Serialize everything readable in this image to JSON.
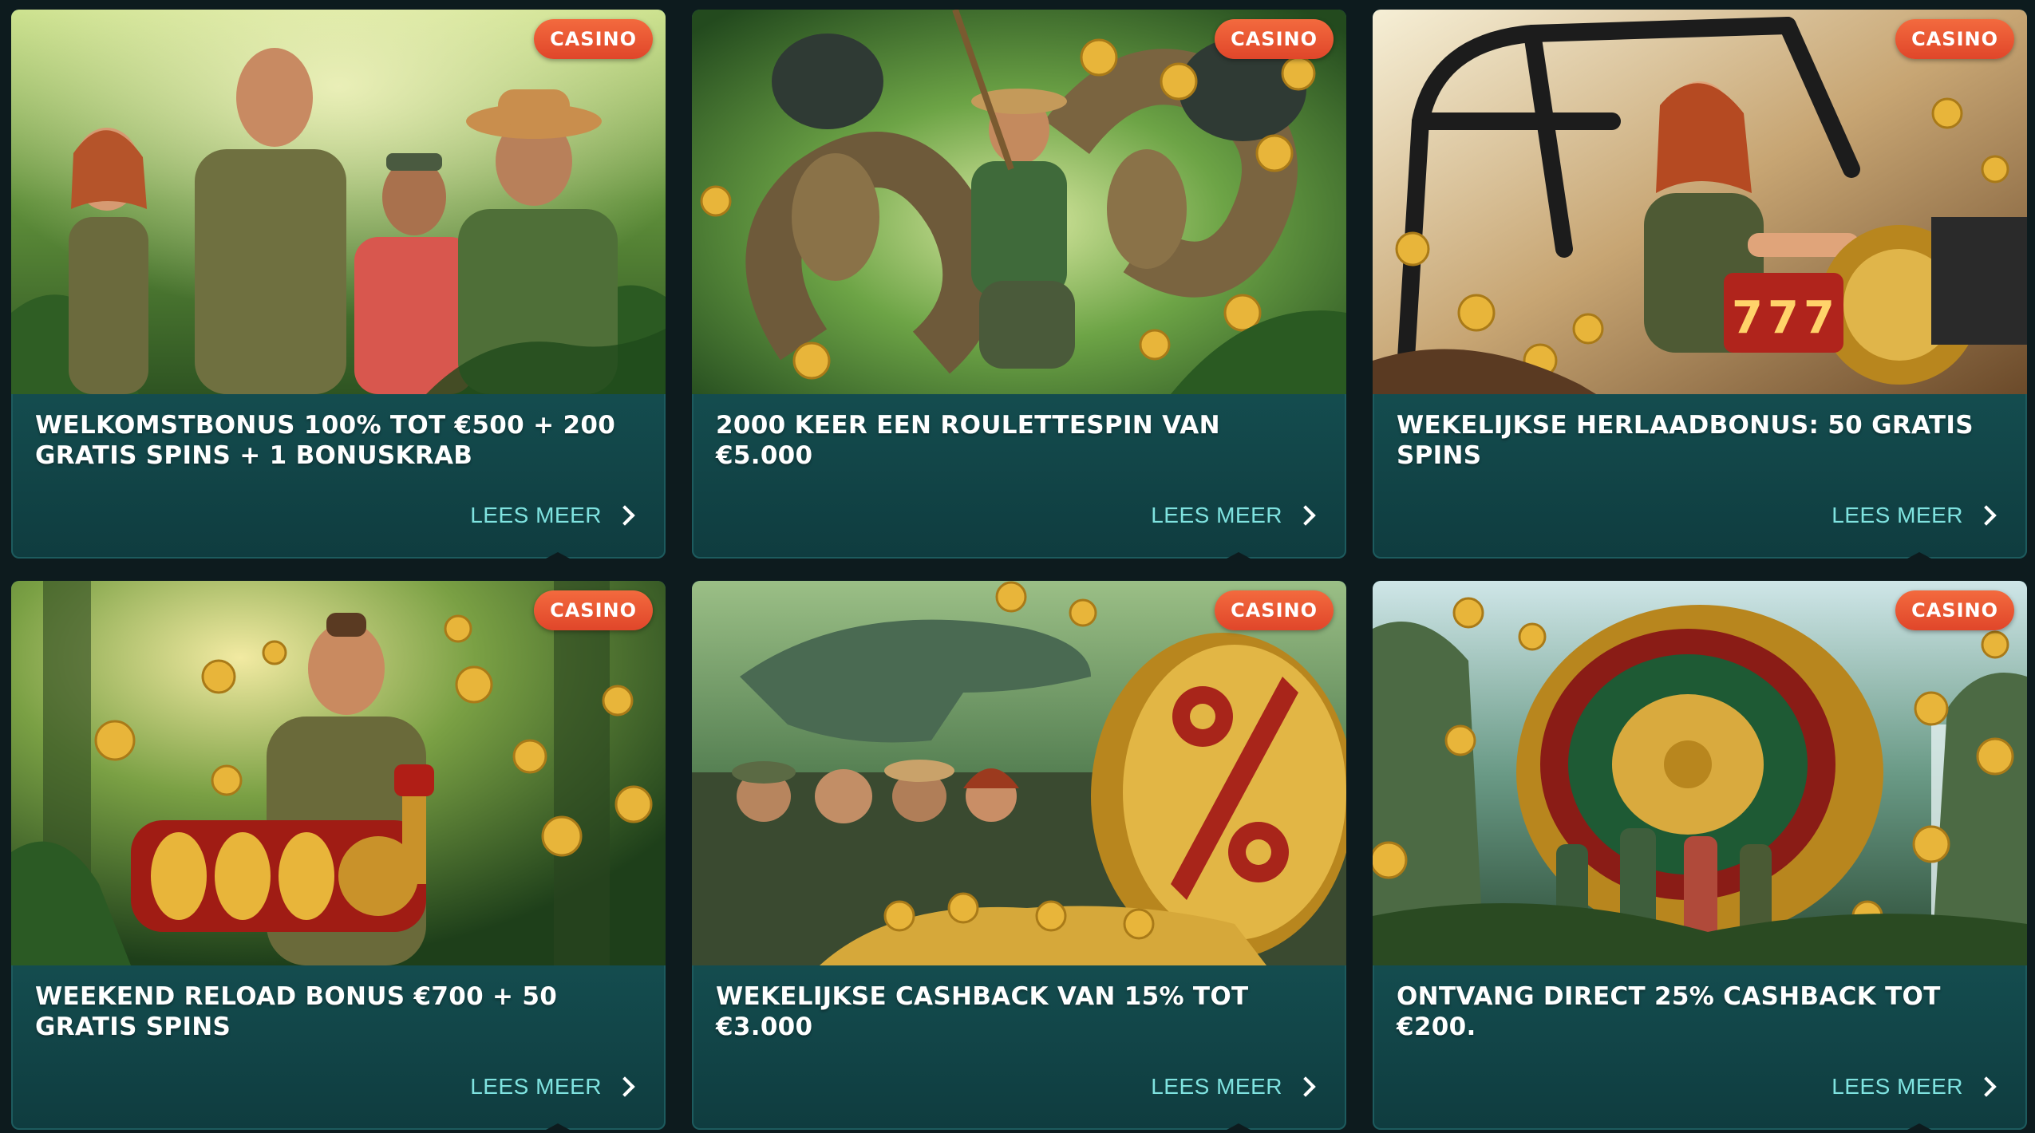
{
  "promotions": [
    {
      "badge": "CASINO",
      "title": "WELKOMSTBONUS 100% TOT €500 + 200 GRATIS SPINS + 1 BONUSKRAB",
      "link": "LEES MEER",
      "image": "jungle-explorers-group"
    },
    {
      "badge": "CASINO",
      "title": "2000 KEER EEN ROULETTESPIN VAN €5.000",
      "link": "LEES MEER",
      "image": "explorer-swinging-with-python-and-gorillas"
    },
    {
      "badge": "CASINO",
      "title": "WEKELIJKSE HERLAADBONUS: 50 GRATIS SPINS",
      "link": "LEES MEER",
      "image": "woman-driving-buggy-with-slot-reels"
    },
    {
      "badge": "CASINO",
      "title": "WEEKEND RELOAD BONUS €700 + 50 GRATIS SPINS",
      "link": "LEES MEER",
      "image": "explorer-holding-slot-reels"
    },
    {
      "badge": "CASINO",
      "title": "WEKELIJKSE CASHBACK VAN 15% TOT €3.000",
      "link": "LEES MEER",
      "image": "crocodile-and-giant-percent-coin"
    },
    {
      "badge": "CASINO",
      "title": "ONTVANG DIRECT 25% CASHBACK TOT €200.",
      "link": "LEES MEER",
      "image": "giant-roulette-wheel-waterfall"
    }
  ],
  "colors": {
    "page_background": "#0d1b1e",
    "card_top": "#1f6e6e",
    "card_bottom": "#0f3c3f",
    "badge": "#e8502f",
    "link": "#7fe3e0",
    "title": "#ffffff"
  }
}
